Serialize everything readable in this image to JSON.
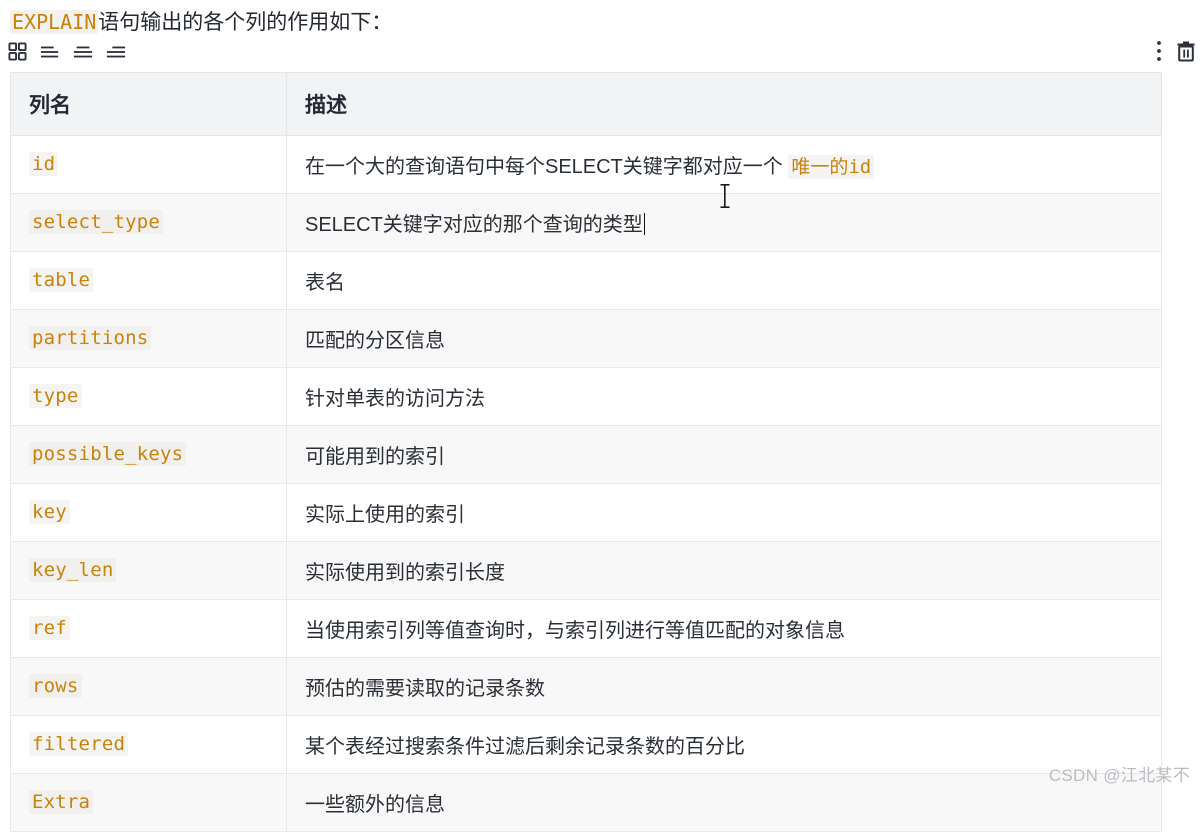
{
  "intro": {
    "code_keyword": "EXPLAIN",
    "text": "语句输出的各个列的作用如下："
  },
  "toolbar": {
    "left_icons": [
      {
        "name": "table-grid-icon",
        "label": "表格"
      },
      {
        "name": "align-left-icon",
        "label": "左对齐"
      },
      {
        "name": "align-center-icon",
        "label": "居中对齐"
      },
      {
        "name": "align-right-icon",
        "label": "右对齐"
      }
    ],
    "right_icons": [
      {
        "name": "more-vertical-icon",
        "label": "更多"
      },
      {
        "name": "trash-icon",
        "label": "删除"
      }
    ]
  },
  "table": {
    "headers": [
      "列名",
      "描述"
    ],
    "rows": [
      {
        "col": "id",
        "desc_prefix": "在一个大的查询语句中每个SELECT关键字都对应一个 ",
        "desc_code": "唯一的id",
        "desc_suffix": ""
      },
      {
        "col": "select_type",
        "desc_prefix": "SELECT关键字对应的那个查询的类型",
        "desc_code": "",
        "desc_suffix": "",
        "caret": true
      },
      {
        "col": "table",
        "desc_prefix": "表名",
        "desc_code": "",
        "desc_suffix": ""
      },
      {
        "col": "partitions",
        "desc_prefix": "匹配的分区信息",
        "desc_code": "",
        "desc_suffix": ""
      },
      {
        "col": "type",
        "desc_prefix": "针对单表的访问方法",
        "desc_code": "",
        "desc_suffix": ""
      },
      {
        "col": "possible_keys",
        "desc_prefix": "可能用到的索引",
        "desc_code": "",
        "desc_suffix": ""
      },
      {
        "col": "key",
        "desc_prefix": "实际上使用的索引",
        "desc_code": "",
        "desc_suffix": ""
      },
      {
        "col": "key_len",
        "desc_prefix": "实际使用到的索引长度",
        "desc_code": "",
        "desc_suffix": ""
      },
      {
        "col": "ref",
        "desc_prefix": "当使用索引列等值查询时，与索引列进行等值匹配的对象信息",
        "desc_code": "",
        "desc_suffix": ""
      },
      {
        "col": "rows",
        "desc_prefix": "预估的需要读取的记录条数",
        "desc_code": "",
        "desc_suffix": ""
      },
      {
        "col": "filtered",
        "desc_prefix": "某个表经过搜索条件过滤后剩余记录条数的百分比",
        "desc_code": "",
        "desc_suffix": ""
      },
      {
        "col": "Extra",
        "desc_prefix": "一些额外的信息",
        "desc_code": "",
        "desc_suffix": ""
      }
    ]
  },
  "watermark": "CSDN @江北某不",
  "colors": {
    "code_orange": "#c8820f",
    "header_bg": "#f2f3f5",
    "stripe_bg": "#f8f8f8",
    "border": "#e3e5e8",
    "text": "#2a2f36",
    "watermark": "#b9bcc1"
  }
}
